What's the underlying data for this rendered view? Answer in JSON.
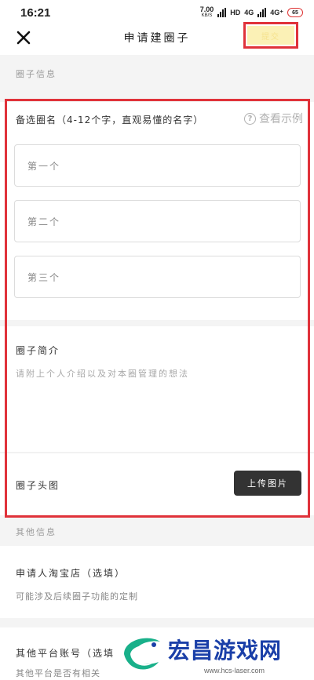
{
  "status_bar": {
    "time": "16:21",
    "net_speed": "7.00",
    "net_speed_unit": "KB/S",
    "hd": "HD",
    "sig1": "4G",
    "sig2": "4G⁺",
    "battery": "65"
  },
  "header": {
    "title": "申请建圈子",
    "submit_label": "提交",
    "close_icon": "close-icon"
  },
  "sections": {
    "circle_info": "圈子信息",
    "other_info": "其他信息"
  },
  "form": {
    "names_title": "备选圈名（4-12个字，直观易懂的名字）",
    "example_link": "查看示例",
    "name_placeholders": [
      "第一个",
      "第二个",
      "第三个"
    ],
    "intro_title": "圈子简介",
    "intro_placeholder": "请附上个人介绍以及对本圈管理的想法",
    "avatar_label": "圈子头图",
    "upload_button": "上传图片"
  },
  "other": {
    "taobao_title": "申请人淘宝店（选填）",
    "taobao_sub": "可能涉及后续圈子功能的定制",
    "platform_title": "其他平台账号（选填",
    "platform_sub": "其他平台是否有相关"
  },
  "watermark": {
    "text": "宏昌游戏网",
    "url": "www.hcs-laser.com"
  },
  "colors": {
    "highlight": "#e0323a",
    "submit_bg": "#fbf1b6",
    "upload_bg": "#333333"
  }
}
